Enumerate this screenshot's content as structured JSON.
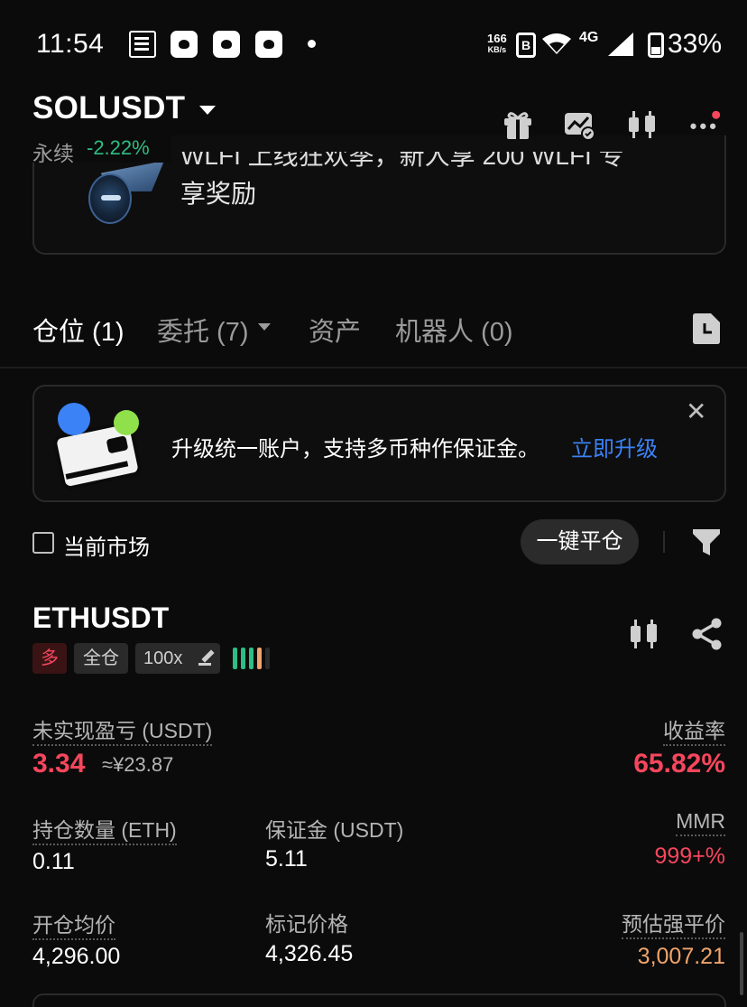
{
  "status_bar": {
    "time": "11:54",
    "net_speed": "166",
    "net_unit": "KB/s",
    "network": "4G",
    "battery": "33%"
  },
  "header": {
    "pair": "SOLUSDT",
    "contract_type": "永续",
    "change": "-2.22%",
    "icons": [
      "gift-icon",
      "chart-settings-icon",
      "candlestick-icon",
      "more-icon"
    ]
  },
  "banner": {
    "text_line1": "WLFI 上线狂欢季，新人享 200 WLFI 专",
    "text_line2": "享奖励"
  },
  "tabs": [
    {
      "label": "仓位 (1)",
      "active": true
    },
    {
      "label": "委托 (7)",
      "active": false
    },
    {
      "label": "资产",
      "active": false
    },
    {
      "label": "机器人 (0)",
      "active": false
    }
  ],
  "upgrade": {
    "text": "升级统一账户，支持多币种作保证金。",
    "link": "立即升级"
  },
  "filter": {
    "current_market": "当前市场",
    "close_all": "一键平仓"
  },
  "position": {
    "symbol": "ETHUSDT",
    "side": "多",
    "margin_mode": "全仓",
    "leverage": "100x",
    "unrealized_pnl_label": "未实现盈亏 (USDT)",
    "unrealized_pnl": "3.34",
    "unrealized_pnl_cny": "≈¥23.87",
    "roe_label": "收益率",
    "roe": "65.82%",
    "size_label": "持仓数量 (ETH)",
    "size": "0.11",
    "margin_label": "保证金 (USDT)",
    "margin": "5.11",
    "mmr_label": "MMR",
    "mmr": "999+%",
    "entry_label": "开仓均价",
    "entry": "4,296.00",
    "mark_label": "标记价格",
    "mark": "4,326.45",
    "liq_label": "预估强平价",
    "liq": "3,007.21"
  },
  "colors": {
    "up": "#2ebd85",
    "down": "#f6465d",
    "link": "#3b82f6",
    "liq": "#f0a46c"
  }
}
